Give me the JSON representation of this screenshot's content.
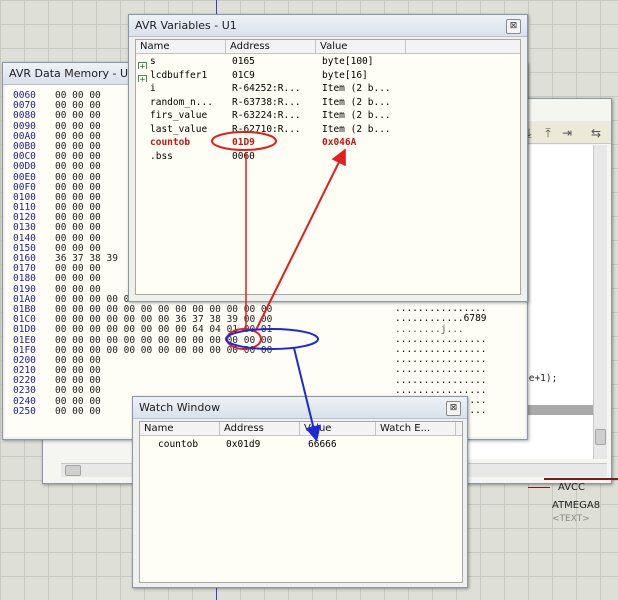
{
  "variables_window": {
    "title": "AVR Variables - U1",
    "columns": [
      "Name",
      "Address",
      "Value"
    ],
    "rows": [
      {
        "name": "s",
        "address": "0165",
        "value": "byte[100]",
        "expandable": true
      },
      {
        "name": "lcdbuffer1",
        "address": "01C9",
        "value": "byte[16]",
        "expandable": true
      },
      {
        "name": "i",
        "address": "R-64252:R...",
        "value": "Item (2 b...",
        "expandable": false
      },
      {
        "name": "random_n...",
        "address": "R-63738:R...",
        "value": "Item (2 b...",
        "expandable": false
      },
      {
        "name": "firs_value",
        "address": "R-63224:R...",
        "value": "Item (2 b...",
        "expandable": false
      },
      {
        "name": "last_value",
        "address": "R-62710:R...",
        "value": "Item (2 b...",
        "expandable": false
      },
      {
        "name": "countob",
        "address": "01D9",
        "value": "0x046A",
        "expandable": false,
        "highlighted": true
      },
      {
        "name": ".bss",
        "address": "0060",
        "value": "",
        "expandable": false
      }
    ]
  },
  "memory_window": {
    "title": "AVR Data Memory - U1",
    "rows": [
      {
        "addr": "0060",
        "bytes": "00 00 00"
      },
      {
        "addr": "0070",
        "bytes": "00 00 00"
      },
      {
        "addr": "0080",
        "bytes": "00 00 00"
      },
      {
        "addr": "0090",
        "bytes": "00 00 00"
      },
      {
        "addr": "00A0",
        "bytes": "00 00 00"
      },
      {
        "addr": "00B0",
        "bytes": "00 00 00"
      },
      {
        "addr": "00C0",
        "bytes": "00 00 00"
      },
      {
        "addr": "00D0",
        "bytes": "00 00 00"
      },
      {
        "addr": "00E0",
        "bytes": "00 00 00"
      },
      {
        "addr": "00F0",
        "bytes": "00 00 00"
      },
      {
        "addr": "0100",
        "bytes": "00 00 00"
      },
      {
        "addr": "0110",
        "bytes": "00 00 00"
      },
      {
        "addr": "0120",
        "bytes": "00 00 00"
      },
      {
        "addr": "0130",
        "bytes": "00 00 00"
      },
      {
        "addr": "0140",
        "bytes": "00 00 00"
      },
      {
        "addr": "0150",
        "bytes": "00 00 00"
      },
      {
        "addr": "0160",
        "bytes": "36 37 38 39"
      },
      {
        "addr": "0170",
        "bytes": "00 00 00"
      },
      {
        "addr": "0180",
        "bytes": "00 00 00"
      },
      {
        "addr": "0190",
        "bytes": "00 00 00"
      },
      {
        "addr": "01A0",
        "bytes": "00 00 00 00 00 00 00 00 00 00 00 00 00"
      },
      {
        "addr": "01B0",
        "bytes": "00 00 00 00 00 00 00 00 00 00 00 00 00"
      },
      {
        "addr": "01C0",
        "bytes": "00 00 00 00 00 00 00 36 37 38 39 00 00"
      },
      {
        "addr": "01D0",
        "bytes": "00 00 00 00 00 00 00 00 64 04 01 00 01"
      },
      {
        "addr": "01E0",
        "bytes": "00 00 00 00 00 00 00 00 00 00 00 00 00"
      },
      {
        "addr": "01F0",
        "bytes": "00 00 00 00 00 00 00 00 00 00 00 00 00"
      },
      {
        "addr": "0200",
        "bytes": "00 00 00"
      },
      {
        "addr": "0210",
        "bytes": "00 00 00"
      },
      {
        "addr": "0220",
        "bytes": "00 00 00"
      },
      {
        "addr": "0230",
        "bytes": "00 00 00"
      },
      {
        "addr": "0240",
        "bytes": "00 00 00"
      },
      {
        "addr": "0250",
        "bytes": "00 00 00"
      }
    ],
    "ascii_rows": [
      "................",
      "................",
      "............6789",
      "........j...",
      "................",
      "................",
      "................",
      "................",
      "................",
      "................",
      "................",
      "................"
    ]
  },
  "watch_window": {
    "title": "Watch Window",
    "columns": [
      "Name",
      "Address",
      "Value",
      "Watch E..."
    ],
    "rows": [
      {
        "name": "countob",
        "address": "0x01d9",
        "value": "66666"
      }
    ]
  },
  "code_fragment": "ue+1);",
  "schematic": {
    "pin_label": "AVCC",
    "chip_label": "ATMEGA8",
    "text_placeholder": "<TEXT>"
  },
  "colors": {
    "annotation_red": "#e02020",
    "annotation_blue": "#1c2ad6",
    "highlight_red": "#c01818"
  }
}
